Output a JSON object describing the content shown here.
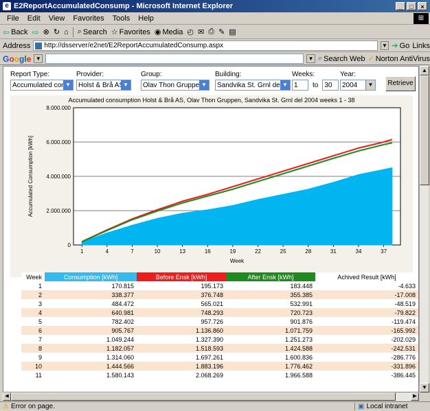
{
  "window": {
    "title": "E2ReportAccumulatedConsump - Microsoft Internet Explorer"
  },
  "menu": [
    "File",
    "Edit",
    "View",
    "Favorites",
    "Tools",
    "Help"
  ],
  "toolbar": {
    "back": "Back",
    "search": "Search",
    "favorites": "Favorites",
    "media": "Media"
  },
  "address": {
    "label": "Address",
    "url": "http://dsserver/e2net/E2ReportAccumulatedConsump.aspx",
    "go": "Go",
    "links": "Links"
  },
  "google": {
    "search_web": "Search Web",
    "norton": "Norton AntiVirus"
  },
  "form": {
    "report_type_label": "Report Type:",
    "report_type_value": "Accumulated consu",
    "provider_label": "Provider:",
    "provider_value": "Holst & Brå AS",
    "group_label": "Group:",
    "group_value": "Olav Thon Gruppen",
    "building_label": "Building:",
    "building_value": "Sandvika St. Grnl del",
    "weeks_label": "Weeks:",
    "weeks_from": "1",
    "weeks_to_label": "to",
    "weeks_to": "30",
    "year_label": "Year:",
    "year_value": "2004",
    "retrieve_label": "Retrieve"
  },
  "chart_data": {
    "type": "area",
    "title": "Accumulated consumption Holst & Brå AS, Olav Thon Gruppen, Sandvika St. Grnl del 2004 weeks 1 - 38",
    "xlabel": "Week",
    "ylabel": "Accumulated Consumption [kWh]",
    "ylim": [
      0,
      8000000
    ],
    "yticks": [
      "0",
      "2.000.000",
      "4.000.000",
      "6.000.000",
      "8.000.000"
    ],
    "xticks": [
      1,
      4,
      7,
      10,
      13,
      16,
      19,
      22,
      25,
      28,
      31,
      34,
      37
    ],
    "x": [
      1,
      4,
      7,
      10,
      13,
      16,
      19,
      22,
      25,
      28,
      31,
      34,
      37,
      38
    ],
    "series": [
      {
        "name": "Consumption [kWh]",
        "color": "#00b5f0",
        "values": [
          170815,
          700000,
          1150000,
          1550000,
          1850000,
          2050000,
          2300000,
          2650000,
          2950000,
          3250000,
          3650000,
          4100000,
          4400000,
          4500000
        ]
      },
      {
        "name": "Before Ensk [kWh]",
        "color": "#ee1c1c",
        "values": [
          195173,
          880000,
          1520000,
          2050000,
          2550000,
          2950000,
          3400000,
          3850000,
          4300000,
          4750000,
          5200000,
          5650000,
          6000000,
          6150000
        ]
      },
      {
        "name": "After Ensk [kWh]",
        "color": "#1f8b1f",
        "values": [
          183448,
          840000,
          1470000,
          1980000,
          2450000,
          2850000,
          3250000,
          3700000,
          4150000,
          4600000,
          5050000,
          5480000,
          5850000,
          5950000
        ]
      }
    ]
  },
  "table": {
    "headers": [
      "Week",
      "Consumption [kWh]",
      "Before Ensk [kWh]",
      "After Ensk [kWh]",
      "Achived Result [kWh]"
    ],
    "rows": [
      [
        "1",
        "170.815",
        "195.173",
        "183.448",
        "-4.633"
      ],
      [
        "2",
        "338.377",
        "376.748",
        "355.385",
        "-17.008"
      ],
      [
        "3",
        "484.472",
        "565.021",
        "532.991",
        "-48.519"
      ],
      [
        "4",
        "640.981",
        "748.293",
        "720.723",
        "-79.822"
      ],
      [
        "5",
        "782.402",
        "957.726",
        "901.876",
        "-119.474"
      ],
      [
        "6",
        "905.767",
        "1.136.860",
        "1.071.759",
        "-165.992"
      ],
      [
        "7",
        "1.049.244",
        "1.327.390",
        "1.251.273",
        "-202.029"
      ],
      [
        "8",
        "1.182.057",
        "1.518.593",
        "1.424.588",
        "-242.531"
      ],
      [
        "9",
        "1.314.060",
        "1.697.261",
        "1.600.836",
        "-286.776"
      ],
      [
        "10",
        "1.444.566",
        "1.883.196",
        "1.776.462",
        "-331.896"
      ],
      [
        "11",
        "1.580.143",
        "2.068.269",
        "1.966.588",
        "-386.445"
      ]
    ]
  },
  "status": {
    "left": "Error on page.",
    "zone": "Local intranet"
  }
}
